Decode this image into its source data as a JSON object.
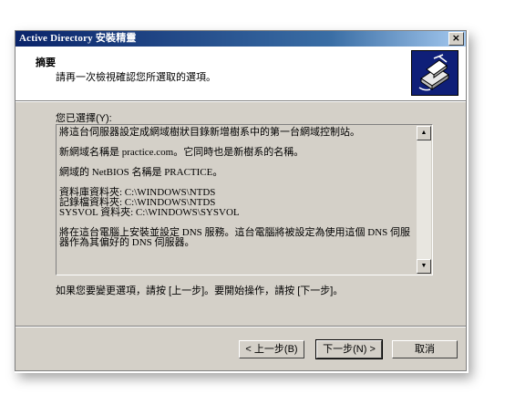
{
  "window": {
    "title": "Active Directory 安裝精靈",
    "close_label": "×"
  },
  "header": {
    "title": "摘要",
    "subtitle": "請再一次檢視確認您所選取的選項。",
    "icon": "wizard-server-icon"
  },
  "main": {
    "selection_label": "您已選擇(Y):",
    "summary_text": "將這台伺服器設定成網域樹狀目錄新增樹系中的第一台網域控制站。\n\n新網域名稱是 practice.com。它同時也是新樹系的名稱。\n\n網域的 NetBIOS 名稱是 PRACTICE。\n\n資料庫資料夾: C:\\WINDOWS\\NTDS\n記錄檔資料夾: C:\\WINDOWS\\NTDS\nSYSVOL 資料夾: C:\\WINDOWS\\SYSVOL\n\n將在這台電腦上安裝並設定 DNS 服務。這台電腦將被設定為使用這個 DNS 伺服器作為其偏好的 DNS 伺服器。",
    "instruction": "如果您要變更選項，請按 [上一步]。要開始操作，請按 [下一步]。"
  },
  "buttons": {
    "back": "< 上一步(B)",
    "next": "下一步(N) >",
    "cancel": "取消"
  },
  "colors": {
    "titlebar_start": "#0a246a",
    "titlebar_end": "#a6caf0",
    "dialog_face": "#d4d0c8",
    "icon_bg": "#0f1f78"
  }
}
